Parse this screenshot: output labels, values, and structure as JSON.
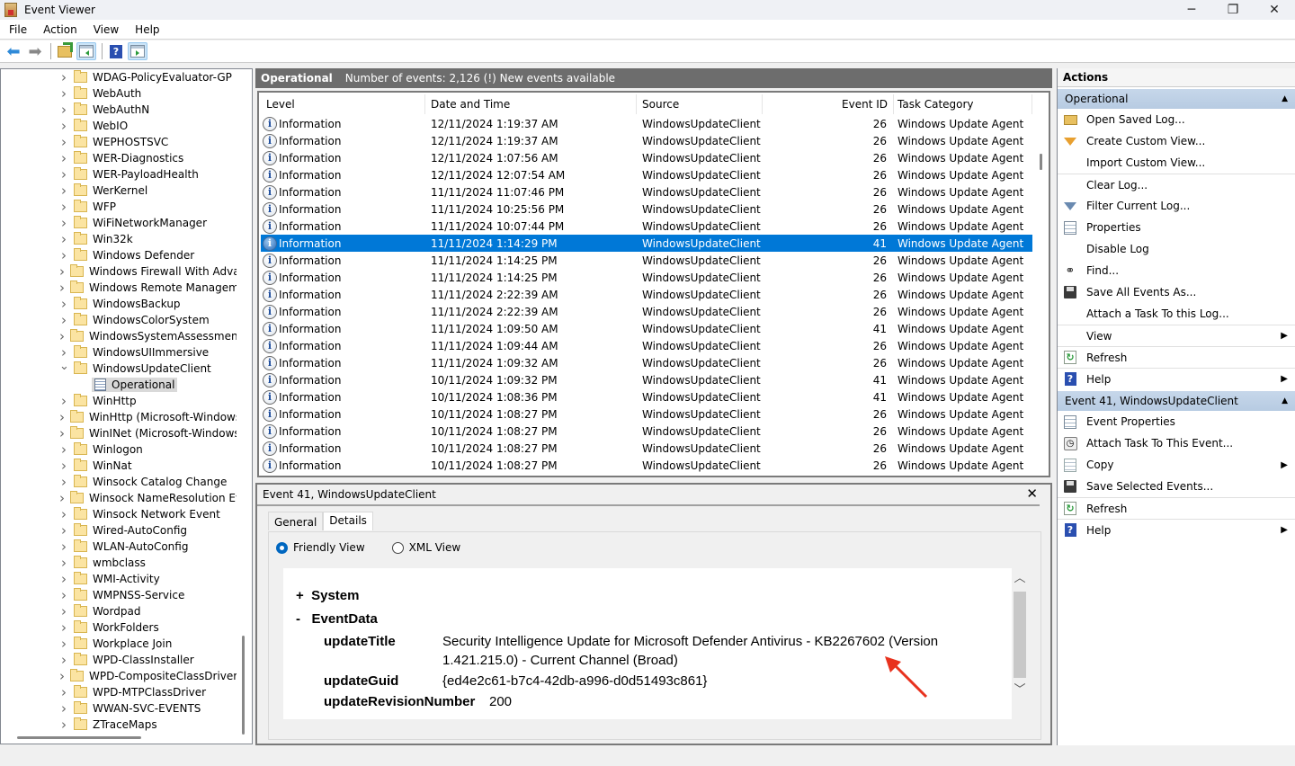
{
  "window": {
    "title": "Event Viewer",
    "controls": {
      "minimize": "─",
      "restore": "❐",
      "close": "✕"
    }
  },
  "menu": [
    "File",
    "Action",
    "View",
    "Help"
  ],
  "toolbar": {
    "buttons": [
      "back-arrow",
      "forward-arrow",
      "up-folder",
      "show-hide-console-tree",
      "help",
      "show-hide-action-pane"
    ]
  },
  "tree": {
    "items": [
      {
        "label": "WDAG-PolicyEvaluator-GP",
        "expanded": false
      },
      {
        "label": "WebAuth",
        "expanded": false
      },
      {
        "label": "WebAuthN",
        "expanded": false
      },
      {
        "label": "WebIO",
        "expanded": false
      },
      {
        "label": "WEPHOSTSVC",
        "expanded": false
      },
      {
        "label": "WER-Diagnostics",
        "expanded": false
      },
      {
        "label": "WER-PayloadHealth",
        "expanded": false
      },
      {
        "label": "WerKernel",
        "expanded": false
      },
      {
        "label": "WFP",
        "expanded": false
      },
      {
        "label": "WiFiNetworkManager",
        "expanded": false
      },
      {
        "label": "Win32k",
        "expanded": false
      },
      {
        "label": "Windows Defender",
        "expanded": false
      },
      {
        "label": "Windows Firewall With Advanced Security",
        "expanded": false
      },
      {
        "label": "Windows Remote Management",
        "expanded": false
      },
      {
        "label": "WindowsBackup",
        "expanded": false
      },
      {
        "label": "WindowsColorSystem",
        "expanded": false
      },
      {
        "label": "WindowsSystemAssessmentTool",
        "expanded": false
      },
      {
        "label": "WindowsUIImmersive",
        "expanded": false
      },
      {
        "label": "WindowsUpdateClient",
        "expanded": true
      },
      {
        "label": "Operational",
        "child": true,
        "selected": true
      },
      {
        "label": "WinHttp",
        "expanded": false
      },
      {
        "label": "WinHttp (Microsoft-Windows-WinINet-Capture)",
        "expanded": false
      },
      {
        "label": "WinINet (Microsoft-Windows-WinINet-Config)",
        "expanded": false
      },
      {
        "label": "Winlogon",
        "expanded": false
      },
      {
        "label": "WinNat",
        "expanded": false
      },
      {
        "label": "Winsock Catalog Change",
        "expanded": false
      },
      {
        "label": "Winsock NameResolution Event",
        "expanded": false
      },
      {
        "label": "Winsock Network Event",
        "expanded": false
      },
      {
        "label": "Wired-AutoConfig",
        "expanded": false
      },
      {
        "label": "WLAN-AutoConfig",
        "expanded": false
      },
      {
        "label": "wmbclass",
        "expanded": false
      },
      {
        "label": "WMI-Activity",
        "expanded": false
      },
      {
        "label": "WMPNSS-Service",
        "expanded": false
      },
      {
        "label": "Wordpad",
        "expanded": false
      },
      {
        "label": "WorkFolders",
        "expanded": false
      },
      {
        "label": "Workplace Join",
        "expanded": false
      },
      {
        "label": "WPD-ClassInstaller",
        "expanded": false
      },
      {
        "label": "WPD-CompositeClassDriver",
        "expanded": false
      },
      {
        "label": "WPD-MTPClassDriver",
        "expanded": false
      },
      {
        "label": "WWAN-SVC-EVENTS",
        "expanded": false
      },
      {
        "label": "ZTraceMaps",
        "expanded": false
      }
    ]
  },
  "log": {
    "name": "Operational",
    "summary": "Number of events: 2,126 (!) New events available",
    "columns": [
      "Level",
      "Date and Time",
      "Source",
      "Event ID",
      "Task Category"
    ],
    "rows": [
      {
        "level": "Information",
        "date": "12/11/2024 1:19:37 AM",
        "source": "WindowsUpdateClient",
        "id": "26",
        "task": "Windows Update Agent"
      },
      {
        "level": "Information",
        "date": "12/11/2024 1:19:37 AM",
        "source": "WindowsUpdateClient",
        "id": "26",
        "task": "Windows Update Agent"
      },
      {
        "level": "Information",
        "date": "12/11/2024 1:07:56 AM",
        "source": "WindowsUpdateClient",
        "id": "26",
        "task": "Windows Update Agent"
      },
      {
        "level": "Information",
        "date": "12/11/2024 12:07:54 AM",
        "source": "WindowsUpdateClient",
        "id": "26",
        "task": "Windows Update Agent"
      },
      {
        "level": "Information",
        "date": "11/11/2024 11:07:46 PM",
        "source": "WindowsUpdateClient",
        "id": "26",
        "task": "Windows Update Agent"
      },
      {
        "level": "Information",
        "date": "11/11/2024 10:25:56 PM",
        "source": "WindowsUpdateClient",
        "id": "26",
        "task": "Windows Update Agent"
      },
      {
        "level": "Information",
        "date": "11/11/2024 10:07:44 PM",
        "source": "WindowsUpdateClient",
        "id": "26",
        "task": "Windows Update Agent"
      },
      {
        "level": "Information",
        "date": "11/11/2024 1:14:29 PM",
        "source": "WindowsUpdateClient",
        "id": "41",
        "task": "Windows Update Agent",
        "selected": true
      },
      {
        "level": "Information",
        "date": "11/11/2024 1:14:25 PM",
        "source": "WindowsUpdateClient",
        "id": "26",
        "task": "Windows Update Agent"
      },
      {
        "level": "Information",
        "date": "11/11/2024 1:14:25 PM",
        "source": "WindowsUpdateClient",
        "id": "26",
        "task": "Windows Update Agent"
      },
      {
        "level": "Information",
        "date": "11/11/2024 2:22:39 AM",
        "source": "WindowsUpdateClient",
        "id": "26",
        "task": "Windows Update Agent"
      },
      {
        "level": "Information",
        "date": "11/11/2024 2:22:39 AM",
        "source": "WindowsUpdateClient",
        "id": "26",
        "task": "Windows Update Agent"
      },
      {
        "level": "Information",
        "date": "11/11/2024 1:09:50 AM",
        "source": "WindowsUpdateClient",
        "id": "41",
        "task": "Windows Update Agent"
      },
      {
        "level": "Information",
        "date": "11/11/2024 1:09:44 AM",
        "source": "WindowsUpdateClient",
        "id": "26",
        "task": "Windows Update Agent"
      },
      {
        "level": "Information",
        "date": "11/11/2024 1:09:32 AM",
        "source": "WindowsUpdateClient",
        "id": "26",
        "task": "Windows Update Agent"
      },
      {
        "level": "Information",
        "date": "10/11/2024 1:09:32 PM",
        "source": "WindowsUpdateClient",
        "id": "41",
        "task": "Windows Update Agent"
      },
      {
        "level": "Information",
        "date": "10/11/2024 1:08:36 PM",
        "source": "WindowsUpdateClient",
        "id": "41",
        "task": "Windows Update Agent"
      },
      {
        "level": "Information",
        "date": "10/11/2024 1:08:27 PM",
        "source": "WindowsUpdateClient",
        "id": "26",
        "task": "Windows Update Agent"
      },
      {
        "level": "Information",
        "date": "10/11/2024 1:08:27 PM",
        "source": "WindowsUpdateClient",
        "id": "26",
        "task": "Windows Update Agent"
      },
      {
        "level": "Information",
        "date": "10/11/2024 1:08:27 PM",
        "source": "WindowsUpdateClient",
        "id": "26",
        "task": "Windows Update Agent"
      },
      {
        "level": "Information",
        "date": "10/11/2024 1:08:27 PM",
        "source": "WindowsUpdateClient",
        "id": "26",
        "task": "Windows Update Agent"
      }
    ]
  },
  "detail": {
    "title": "Event 41, WindowsUpdateClient",
    "close": "✕",
    "tabs": [
      {
        "label": "General",
        "active": false
      },
      {
        "label": "Details",
        "active": true
      }
    ],
    "views": [
      {
        "label": "Friendly View",
        "checked": true
      },
      {
        "label": "XML View",
        "checked": false
      }
    ],
    "system": {
      "toggle": "+",
      "label": "System"
    },
    "eventdata": {
      "toggle": "-",
      "label": "EventData"
    },
    "fields": [
      {
        "key": "updateTitle",
        "value_line1": "Security Intelligence Update for Microsoft Defender Antivirus - KB2267602 (Version",
        "value_line2": "1.421.215.0) - Current Channel (Broad)"
      },
      {
        "key": "updateGuid",
        "value_line1": "{ed4e2c61-b7c4-42db-a996-d0d51493c861}"
      },
      {
        "key": "updateRevisionNumber",
        "value_line1": "200"
      }
    ],
    "annotation_color": "#e8321e"
  },
  "actions": {
    "title": "Actions",
    "groups": [
      {
        "label": "Operational",
        "items": [
          {
            "label": "Open Saved Log...",
            "icon": "folder-open-icon"
          },
          {
            "label": "Create Custom View...",
            "icon": "filter-new-icon"
          },
          {
            "label": "Import Custom View...",
            "icon": ""
          },
          {
            "label": "Clear Log...",
            "icon": "",
            "sep": true
          },
          {
            "label": "Filter Current Log...",
            "icon": "filter-icon"
          },
          {
            "label": "Properties",
            "icon": "properties-icon"
          },
          {
            "label": "Disable Log",
            "icon": ""
          },
          {
            "label": "Find...",
            "icon": "binoculars-icon"
          },
          {
            "label": "Save All Events As...",
            "icon": "save-icon"
          },
          {
            "label": "Attach a Task To this Log...",
            "icon": ""
          },
          {
            "label": "View",
            "icon": "",
            "submenu": true,
            "sep": true
          },
          {
            "label": "Refresh",
            "icon": "refresh-icon",
            "sep": true
          },
          {
            "label": "Help",
            "icon": "help-icon",
            "submenu": true,
            "sep": true
          }
        ]
      },
      {
        "label": "Event 41, WindowsUpdateClient",
        "items": [
          {
            "label": "Event Properties",
            "icon": "properties-icon"
          },
          {
            "label": "Attach Task To This Event...",
            "icon": "task-icon"
          },
          {
            "label": "Copy",
            "icon": "copy-icon",
            "submenu": true
          },
          {
            "label": "Save Selected Events...",
            "icon": "save-icon"
          },
          {
            "label": "Refresh",
            "icon": "refresh-icon",
            "sep": true
          },
          {
            "label": "Help",
            "icon": "help-icon",
            "submenu": true,
            "sep": true
          }
        ]
      }
    ]
  },
  "colors": {
    "selection": "#0078d7",
    "header_bar": "#6d6d6d",
    "action_group": "#c6d7ea"
  }
}
